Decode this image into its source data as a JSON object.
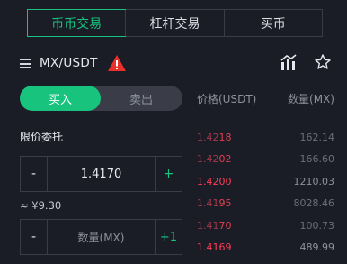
{
  "tabs": [
    {
      "label": "币币交易",
      "active": true
    },
    {
      "label": "杠杆交易",
      "active": false
    },
    {
      "label": "买币",
      "active": false
    }
  ],
  "pair": {
    "name": "MX/USDT",
    "icons": {
      "menu": "menu-icon",
      "warning": "warning-icon",
      "chart": "chart-icon",
      "favorite": "star-icon"
    }
  },
  "side_toggle": {
    "buy": "买入",
    "sell": "卖出",
    "active": "buy"
  },
  "order_type": "限价委托",
  "price_input": {
    "minus": "-",
    "value": "1.4170",
    "plus": "+"
  },
  "approx_value": "≈ ¥9.30",
  "qty_input": {
    "minus": "-",
    "placeholder": "数量(MX)",
    "plus": "+1"
  },
  "orderbook": {
    "price_header": "价格(USDT)",
    "qty_header": "数量(MX)",
    "rows": [
      {
        "price_main": "1.42",
        "price_tail": "18",
        "qty": "162.14"
      },
      {
        "price_main": "1.42",
        "price_tail": "02",
        "qty": "166.60"
      },
      {
        "price_main": "1.4200",
        "price_tail": "",
        "qty": "1210.03"
      },
      {
        "price_main": "1.41",
        "price_tail": "95",
        "qty": "8028.46"
      },
      {
        "price_main": "1.41",
        "price_tail": "70",
        "qty": "100.73"
      },
      {
        "price_main": "1.4169",
        "price_tail": "",
        "qty": "489.99"
      }
    ]
  },
  "colors": {
    "accent": "#17c37d",
    "sell": "#e33f53",
    "background": "#1b1d26",
    "warning": "#e8312b"
  }
}
